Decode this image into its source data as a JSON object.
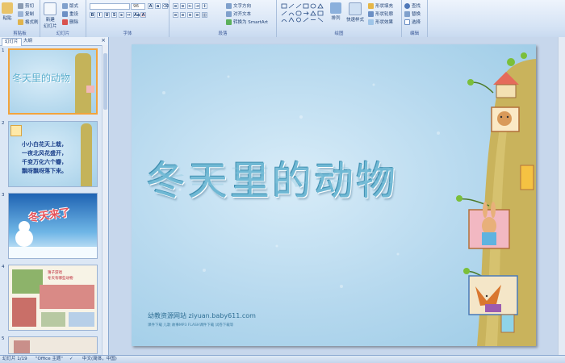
{
  "ribbon": {
    "clipboard": {
      "paste": "粘贴",
      "cut": "剪切",
      "copy": "复制",
      "format_painter": "格式刷",
      "group": "剪贴板"
    },
    "slides": {
      "new_slide": "新建\n幻灯片",
      "layout": "版式",
      "reset": "重设",
      "delete": "删除",
      "group": "幻灯片"
    },
    "font": {
      "name": "",
      "size": "96",
      "group": "字体"
    },
    "paragraph": {
      "text_direction": "文字方向",
      "align_text": "对齐文本",
      "smartart": "转换为 SmartArt",
      "group": "段落"
    },
    "drawing": {
      "arrange": "排列",
      "quick_styles": "快速样式",
      "shape_fill": "形状填充",
      "shape_outline": "形状轮廓",
      "shape_effects": "形状效果",
      "group": "绘图"
    },
    "editing": {
      "find": "查找",
      "replace": "替换",
      "select": "选择",
      "group": "编辑"
    }
  },
  "left_pane": {
    "tabs": [
      "幻灯片",
      "大纲"
    ],
    "close": "×",
    "slides": [
      {
        "num": "1",
        "title": "冬天里的动物",
        "selected": true
      },
      {
        "num": "2",
        "title": "",
        "poem": [
          "小小白花天上栽，",
          "一夜北风花盛开，",
          "千变万化六个瓣，",
          "飘呀飘呀落下来。"
        ]
      },
      {
        "num": "3",
        "title": "冬天来了"
      },
      {
        "num": "4",
        "title": "猜子游戏",
        "subtitle": "冬天有哪些动物"
      },
      {
        "num": "5",
        "title": ""
      }
    ]
  },
  "slide": {
    "title": "冬天里的动物",
    "footer_site": "幼教资源网站  ziyuan.baby611.com",
    "footer_sub": "课件下载   儿歌   故事MP3   FLASH课件下载   试卷下载等"
  },
  "status_bar": {
    "slide_counter": "幻灯片 1/19",
    "theme": "\"Office 主题\"",
    "language": "中文(简体，中国)"
  },
  "colors": {
    "accent": "#f2a33c",
    "ribbon": "#d6e4f5",
    "slide_bg": "#b5d8ee"
  }
}
